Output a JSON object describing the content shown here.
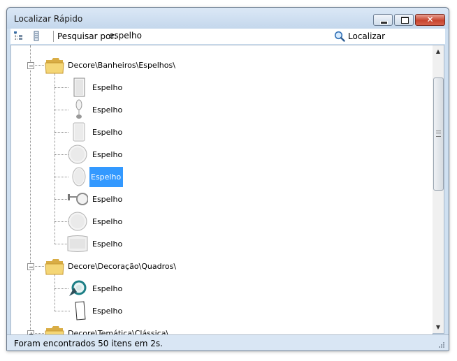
{
  "window": {
    "title": "Localizar Rápido",
    "controls": {
      "minimize": "minimize",
      "maximize": "maximize",
      "close": "close"
    }
  },
  "toolbar": {
    "search_label": "Pesquisar por:",
    "search_value": "espelho",
    "locate_label": "Localizar",
    "icons": [
      "collapse-tree-icon",
      "expand-tree-icon",
      "search-icon"
    ]
  },
  "tree": {
    "groups": [
      {
        "path": "Decore\\Banheiros\\Espelhos\\",
        "expanded": true,
        "items": [
          {
            "label": "Espelho",
            "icon": "mirror-rect-icon"
          },
          {
            "label": "Espelho",
            "icon": "mirror-stand-icon"
          },
          {
            "label": "Espelho",
            "icon": "mirror-tall-icon"
          },
          {
            "label": "Espelho",
            "icon": "mirror-round-icon"
          },
          {
            "label": "Espelho",
            "icon": "mirror-oval-icon",
            "selected": true
          },
          {
            "label": "Espelho",
            "icon": "mirror-arm-icon"
          },
          {
            "label": "Espelho",
            "icon": "mirror-round-icon"
          },
          {
            "label": "Espelho",
            "icon": "mirror-wide-icon"
          }
        ]
      },
      {
        "path": "Decore\\Decoração\\Quadros\\",
        "expanded": true,
        "items": [
          {
            "label": "Espelho",
            "icon": "mirror-ornate-icon"
          },
          {
            "label": "Espelho",
            "icon": "mirror-frame-icon"
          }
        ]
      },
      {
        "path": "Decore\\Temática\\Clássica\\",
        "expanded": false,
        "items": []
      }
    ]
  },
  "status": {
    "text": "Foram encontrados 50 itens em 2s."
  },
  "colors": {
    "selection": "#3399ff",
    "folder": "#e8c25a",
    "title_bar": "#c4d7ec",
    "close_button": "#c8452f"
  }
}
